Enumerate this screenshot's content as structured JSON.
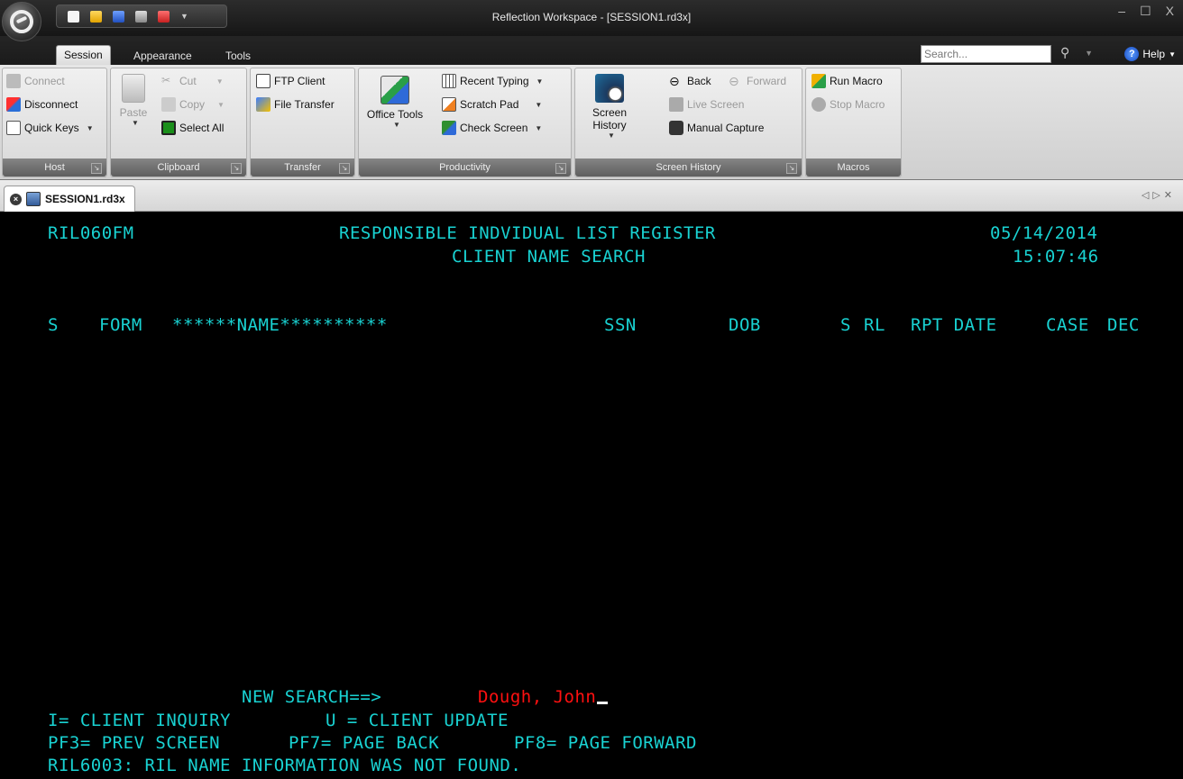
{
  "window": {
    "title": "Reflection Workspace - [SESSION1.rd3x]",
    "minimize_glyph": "–",
    "maximize_glyph": "☐",
    "close_glyph": "X"
  },
  "ribbon_tabs": [
    "Session",
    "Appearance",
    "Tools"
  ],
  "search": {
    "placeholder": "Search..."
  },
  "help_label": "Help",
  "groups": {
    "host": {
      "label": "Host",
      "connect": "Connect",
      "disconnect": "Disconnect",
      "quick_keys": "Quick Keys"
    },
    "clipboard": {
      "label": "Clipboard",
      "paste": "Paste",
      "cut": "Cut",
      "copy": "Copy",
      "select_all": "Select All"
    },
    "transfer": {
      "label": "Transfer",
      "ftp_client": "FTP Client",
      "file_transfer": "File Transfer"
    },
    "productivity": {
      "label": "Productivity",
      "office_tools": "Office Tools",
      "recent_typing": "Recent Typing",
      "scratch_pad": "Scratch Pad",
      "check_screen": "Check Screen"
    },
    "screen_history": {
      "label": "Screen History",
      "screen_history": "Screen History",
      "back": "Back",
      "forward": "Forward",
      "live_screen": "Live Screen",
      "manual_capture": "Manual Capture"
    },
    "macros": {
      "label": "Macros",
      "run_macro": "Run Macro",
      "stop_macro": "Stop Macro"
    }
  },
  "document_tab": {
    "label": "SESSION1.rd3x"
  },
  "terminal": {
    "screen_id": "RIL060FM",
    "title": "RESPONSIBLE INDVIDUAL LIST REGISTER",
    "date": "05/14/2014",
    "subtitle": "CLIENT NAME SEARCH",
    "time": "15:07:46",
    "columns": {
      "s": "S",
      "form": "FORM",
      "name": "******NAME**********",
      "ssn": "SSN",
      "dob": "DOB",
      "s2": "S",
      "rl": "RL",
      "rpt_date": "RPT DATE",
      "case": "CASE",
      "dec": "DEC"
    },
    "new_search_label": "NEW SEARCH==>",
    "new_search_value": "Dough, John",
    "line1_a": "I= CLIENT INQUIRY",
    "line1_b": "U = CLIENT UPDATE",
    "line2_a": "PF3= PREV SCREEN",
    "line2_b": "PF7= PAGE BACK",
    "line2_c": "PF8= PAGE FORWARD",
    "message": "RIL6003: RIL NAME INFORMATION WAS NOT FOUND."
  }
}
